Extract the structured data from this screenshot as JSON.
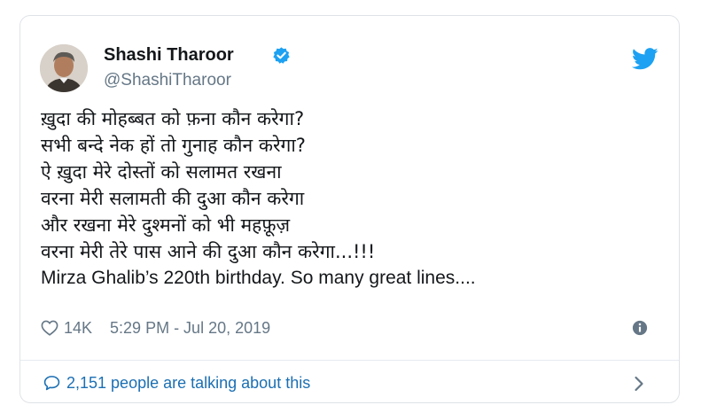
{
  "author": {
    "name": "Shashi Tharoor",
    "handle": "@ShashiTharoor"
  },
  "tweet": {
    "lines": [
      "ख़ुदा की मोहब्बत को फ़ना कौन करेगा?",
      "सभी बन्दे नेक हों तो गुनाह कौन करेगा?",
      "ऐ ख़ुदा मेरे दोस्तों को सलामत रखना",
      "वरना मेरी सलामती की दुआ कौन करेगा",
      "और रखना मेरे दुश्मनों को भी महफ़ूज़",
      "वरना मेरी तेरे पास आने की दुआ कौन करेगा...!!!",
      "Mirza Ghalib’s 220th birthday. So many great lines...."
    ]
  },
  "meta": {
    "likes": "14K",
    "timestamp": "5:29 PM - Jul 20, 2019"
  },
  "conversation": {
    "label": "2,151 people are talking about this"
  },
  "icons": {
    "verified": "verified-badge-icon",
    "brand": "twitter-bird-icon",
    "like": "heart-icon",
    "info": "info-icon",
    "talk": "speech-bubble-icon",
    "more": "chevron-right-icon"
  },
  "colors": {
    "twitter_blue": "#1da1f2",
    "link_blue": "#1b6fb3",
    "text": "#14171a",
    "muted": "#657786"
  }
}
